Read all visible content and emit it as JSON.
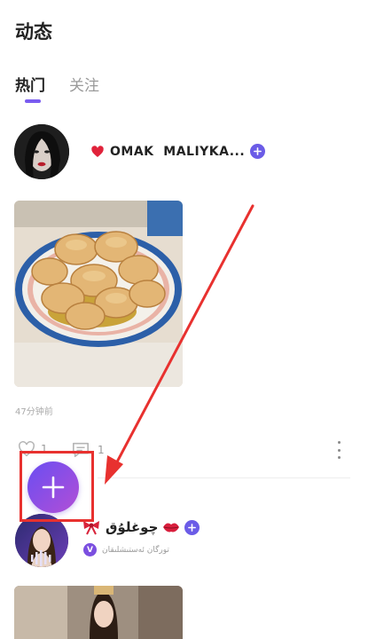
{
  "header": {
    "title": "动态"
  },
  "tabs": [
    {
      "label": "热门",
      "active": true
    },
    {
      "label": "关注",
      "active": false
    }
  ],
  "post1": {
    "username": "OMAK  MALIYKA...",
    "timestamp": "47分钟前",
    "likes": "1",
    "comments": "1",
    "image_icon": "dumplings-photo"
  },
  "post2": {
    "username": "چوغلۇق",
    "subtitle": "تورگان ئەستىشلىقان",
    "verified_label": "V"
  },
  "fab": {
    "icon": "plus-icon"
  },
  "colors": {
    "accent": "#7a5cf0",
    "fab_start": "#6a4df2",
    "fab_end": "#b24fd6",
    "annotation_red": "#e8312f"
  }
}
